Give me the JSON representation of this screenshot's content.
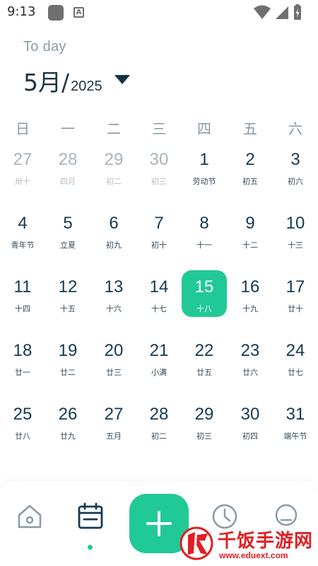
{
  "status_bar": {
    "time": "9:13",
    "icons": [
      "app-square-icon",
      "accessibility-a-icon",
      "wifi-icon",
      "cellular-signal-icon",
      "battery-charging-icon"
    ]
  },
  "header": {
    "today_label": "To day",
    "month": "5月/",
    "year": "2025",
    "dropdown_icon": "caret-down-icon"
  },
  "weekdays": [
    "日",
    "一",
    "二",
    "三",
    "四",
    "五",
    "六"
  ],
  "weeks": [
    [
      {
        "day": "27",
        "sub": "卅十",
        "muted": true
      },
      {
        "day": "28",
        "sub": "四月",
        "muted": true
      },
      {
        "day": "29",
        "sub": "初二",
        "muted": true
      },
      {
        "day": "30",
        "sub": "初三",
        "muted": true
      },
      {
        "day": "1",
        "sub": "劳动节",
        "muted": false
      },
      {
        "day": "2",
        "sub": "初五",
        "muted": false
      },
      {
        "day": "3",
        "sub": "初六",
        "muted": false
      }
    ],
    [
      {
        "day": "4",
        "sub": "青年节",
        "muted": false
      },
      {
        "day": "5",
        "sub": "立夏",
        "muted": false
      },
      {
        "day": "6",
        "sub": "初九",
        "muted": false
      },
      {
        "day": "7",
        "sub": "初十",
        "muted": false
      },
      {
        "day": "8",
        "sub": "十一",
        "muted": false
      },
      {
        "day": "9",
        "sub": "十二",
        "muted": false
      },
      {
        "day": "10",
        "sub": "十三",
        "muted": false
      }
    ],
    [
      {
        "day": "11",
        "sub": "十四",
        "muted": false
      },
      {
        "day": "12",
        "sub": "十五",
        "muted": false
      },
      {
        "day": "13",
        "sub": "十六",
        "muted": false
      },
      {
        "day": "14",
        "sub": "十七",
        "muted": false
      },
      {
        "day": "15",
        "sub": "十八",
        "muted": false,
        "selected": true
      },
      {
        "day": "16",
        "sub": "十九",
        "muted": false
      },
      {
        "day": "17",
        "sub": "廿十",
        "muted": false
      }
    ],
    [
      {
        "day": "18",
        "sub": "廿一",
        "muted": false
      },
      {
        "day": "19",
        "sub": "廿二",
        "muted": false
      },
      {
        "day": "20",
        "sub": "廿三",
        "muted": false
      },
      {
        "day": "21",
        "sub": "小满",
        "muted": false
      },
      {
        "day": "22",
        "sub": "廿五",
        "muted": false
      },
      {
        "day": "23",
        "sub": "廿六",
        "muted": false
      },
      {
        "day": "24",
        "sub": "廿七",
        "muted": false
      }
    ],
    [
      {
        "day": "25",
        "sub": "廿八",
        "muted": false
      },
      {
        "day": "26",
        "sub": "廿九",
        "muted": false
      },
      {
        "day": "27",
        "sub": "五月",
        "muted": false
      },
      {
        "day": "28",
        "sub": "初二",
        "muted": false
      },
      {
        "day": "29",
        "sub": "初三",
        "muted": false
      },
      {
        "day": "30",
        "sub": "初四",
        "muted": false
      },
      {
        "day": "31",
        "sub": "端午节",
        "muted": false
      }
    ]
  ],
  "bottom_nav": {
    "items": [
      "home-icon",
      "calendar-icon",
      "add-icon",
      "clock-icon",
      "profile-face-icon"
    ],
    "active": "calendar-icon"
  },
  "watermark": {
    "title": "千饭手游网",
    "url": "www.eduext.com"
  },
  "colors": {
    "accent": "#21c996",
    "text_dark": "#143a52",
    "muted": "#a9b4bc",
    "watermark_red": "#e01f24"
  }
}
